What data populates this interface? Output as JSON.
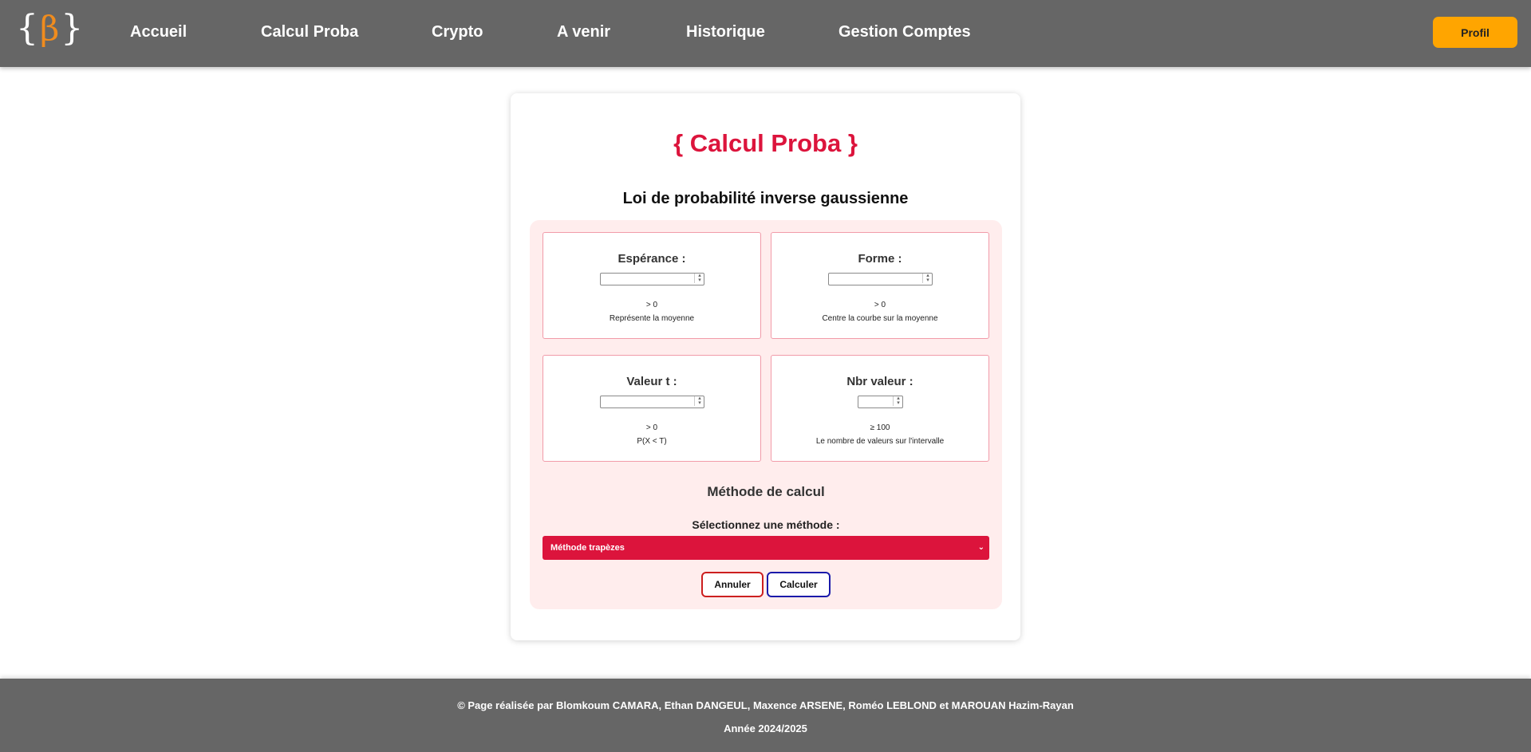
{
  "nav": {
    "logo": {
      "left_brace": "{",
      "symbol": "β",
      "right_brace": "}"
    },
    "links": [
      "Accueil",
      "Calcul Proba",
      "Crypto",
      "A venir",
      "Historique",
      "Gestion Comptes"
    ],
    "profile_label": "Profil"
  },
  "main": {
    "title": "{  Calcul Proba  }",
    "subtitle": "Loi de probabilité inverse gaussienne",
    "fields": [
      {
        "label": "Espérance :",
        "value": "",
        "hint1": "> 0",
        "hint2": "Représente la moyenne"
      },
      {
        "label": "Forme :",
        "value": "",
        "hint1": "> 0",
        "hint2": "Centre la courbe sur la moyenne"
      },
      {
        "label": "Valeur t :",
        "value": "",
        "hint1": "> 0",
        "hint2": "P(X < T)"
      },
      {
        "label": "Nbr valeur :",
        "value": "",
        "hint1": "≥ 100",
        "hint2": "Le nombre de valeurs sur l'intervalle"
      }
    ],
    "method_heading": "Méthode de calcul",
    "method_label": "Sélectionnez une méthode :",
    "method_selected": "Méthode trapèzes",
    "cancel_label": "Annuler",
    "calculate_label": "Calculer"
  },
  "footer": {
    "credits": "© Page réalisée par Blomkoum CAMARA, Ethan DANGEUL, Maxence ARSENE, Roméo LEBLOND et MAROUAN Hazim-Rayan",
    "year": "Année 2024/2025"
  },
  "colors": {
    "navbar": "#666666",
    "accent": "#dc143c",
    "profile_button": "#ffa500",
    "form_background": "#ffeded",
    "logo_symbol": "#f08c1e"
  }
}
